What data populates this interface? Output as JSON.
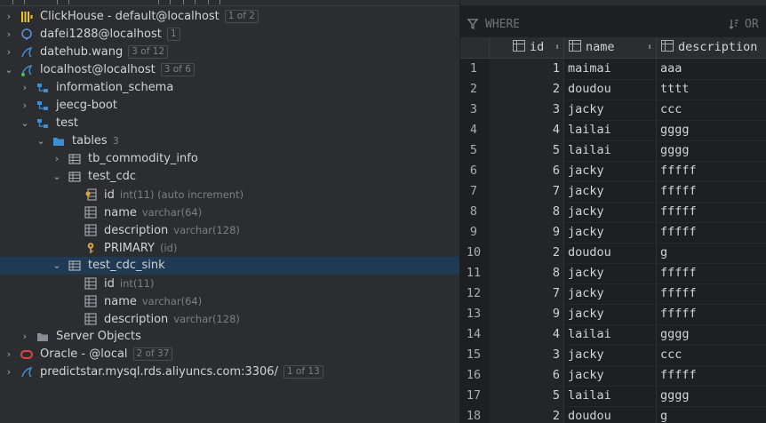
{
  "tree": {
    "rows": [
      {
        "id": "clickhouse",
        "label": "ClickHouse - default@localhost",
        "badge": "1 of 2"
      },
      {
        "id": "dafei",
        "label": "dafei1288@localhost",
        "badge": "1"
      },
      {
        "id": "datehub",
        "label": "datehub.wang",
        "badge": "3 of 12"
      },
      {
        "id": "localhost",
        "label": "localhost@localhost",
        "badge": "3 of 6"
      },
      {
        "id": "information_schema",
        "label": "information_schema"
      },
      {
        "id": "jeecg",
        "label": "jeecg-boot"
      },
      {
        "id": "test",
        "label": "test"
      },
      {
        "id": "tables",
        "label": "tables",
        "count": "3"
      },
      {
        "id": "tb_commodity_info",
        "label": "tb_commodity_info"
      },
      {
        "id": "test_cdc",
        "label": "test_cdc"
      },
      {
        "id": "col_id",
        "label": "id",
        "annotation": "int(11) (auto increment)"
      },
      {
        "id": "col_name",
        "label": "name",
        "annotation": "varchar(64)"
      },
      {
        "id": "col_description",
        "label": "description",
        "annotation": "varchar(128)"
      },
      {
        "id": "primary",
        "label": "PRIMARY",
        "annotation": "(id)"
      },
      {
        "id": "test_cdc_sink",
        "label": "test_cdc_sink"
      },
      {
        "id": "sink_id",
        "label": "id",
        "annotation": "int(11)"
      },
      {
        "id": "sink_name",
        "label": "name",
        "annotation": "varchar(64)"
      },
      {
        "id": "sink_description",
        "label": "description",
        "annotation": "varchar(128)"
      },
      {
        "id": "server_objects",
        "label": "Server Objects"
      },
      {
        "id": "oracle",
        "label": "Oracle - @local",
        "badge": "2 of 37"
      },
      {
        "id": "predictstar",
        "label": "predictstar.mysql.rds.aliyuncs.com:3306/",
        "badge": "1 of 13"
      }
    ]
  },
  "grid": {
    "filter_placeholder": "WHERE",
    "order_placeholder": "OR",
    "columns": [
      "id",
      "name",
      "description"
    ],
    "rows": [
      {
        "n": "1",
        "id": "1",
        "name": "maimai",
        "description": "aaa"
      },
      {
        "n": "2",
        "id": "2",
        "name": "doudou",
        "description": "tttt"
      },
      {
        "n": "3",
        "id": "3",
        "name": "jacky",
        "description": "ccc"
      },
      {
        "n": "4",
        "id": "4",
        "name": "lailai",
        "description": "gggg"
      },
      {
        "n": "5",
        "id": "5",
        "name": "lailai",
        "description": "gggg"
      },
      {
        "n": "6",
        "id": "6",
        "name": "jacky",
        "description": "fffff"
      },
      {
        "n": "7",
        "id": "7",
        "name": "jacky",
        "description": "fffff"
      },
      {
        "n": "8",
        "id": "8",
        "name": "jacky",
        "description": "fffff"
      },
      {
        "n": "9",
        "id": "9",
        "name": "jacky",
        "description": "fffff"
      },
      {
        "n": "10",
        "id": "2",
        "name": "doudou",
        "description": "g"
      },
      {
        "n": "11",
        "id": "8",
        "name": "jacky",
        "description": "fffff"
      },
      {
        "n": "12",
        "id": "7",
        "name": "jacky",
        "description": "fffff"
      },
      {
        "n": "13",
        "id": "9",
        "name": "jacky",
        "description": "fffff"
      },
      {
        "n": "14",
        "id": "4",
        "name": "lailai",
        "description": "gggg"
      },
      {
        "n": "15",
        "id": "3",
        "name": "jacky",
        "description": "ccc"
      },
      {
        "n": "16",
        "id": "6",
        "name": "jacky",
        "description": "fffff"
      },
      {
        "n": "17",
        "id": "5",
        "name": "lailai",
        "description": "gggg"
      },
      {
        "n": "18",
        "id": "2",
        "name": "doudou",
        "description": "g"
      }
    ]
  },
  "colors": {
    "background": "#2b2d30",
    "grid_background": "#1e1f22",
    "selection": "#1f3a52",
    "folder": "#3d8fd1",
    "key": "#d9a343",
    "oracle": "#e4433b",
    "mysql": "#3d8fd1",
    "clickhouse": "#f5c518"
  }
}
